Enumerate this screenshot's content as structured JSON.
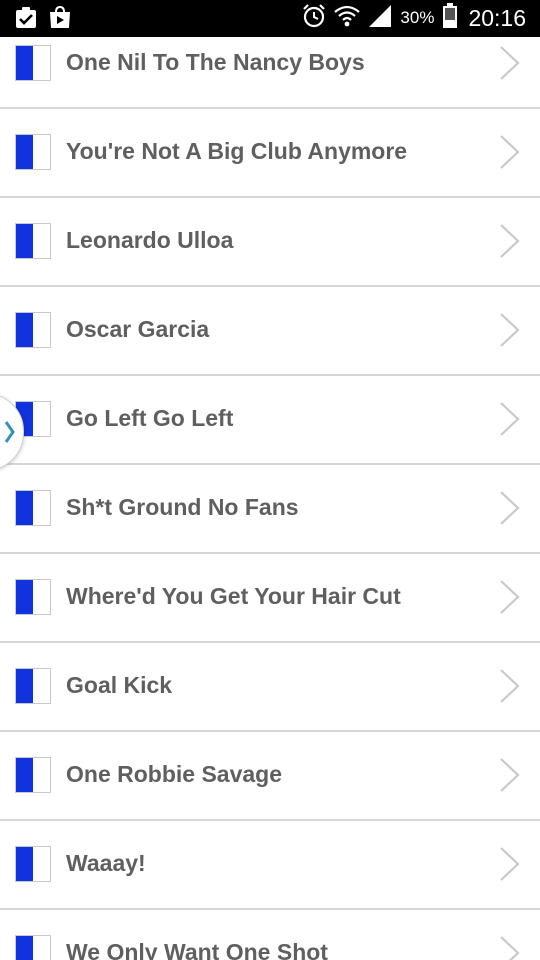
{
  "status_bar": {
    "battery_percent": "30%",
    "time": "20:16",
    "icons": [
      "clipboard-check-icon",
      "play-store-icon",
      "alarm-icon",
      "wifi-icon",
      "signal-icon",
      "battery-icon"
    ]
  },
  "chants": [
    {
      "label": "One Nil To The Nancy Boys"
    },
    {
      "label": "You're Not A Big Club Anymore"
    },
    {
      "label": "Leonardo Ulloa"
    },
    {
      "label": "Oscar Garcia"
    },
    {
      "label": "Go Left Go Left"
    },
    {
      "label": "Sh*t Ground No Fans"
    },
    {
      "label": "Where'd You Get Your Hair Cut"
    },
    {
      "label": "Goal Kick"
    },
    {
      "label": "One Robbie Savage"
    },
    {
      "label": "Waaay!"
    },
    {
      "label": "We Only Want One Shot"
    }
  ],
  "colors": {
    "flag_blue": "#1133dd",
    "text": "#5f5f5f",
    "divider": "#d6d6d6",
    "chevron": "#c9c9c9",
    "drawer_chevron": "#3a8fb0"
  }
}
